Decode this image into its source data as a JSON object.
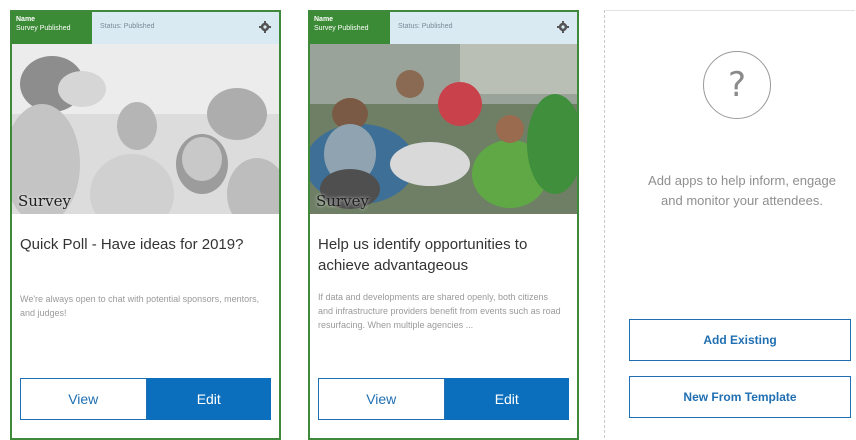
{
  "cards": [
    {
      "badge_line1": "Name",
      "badge_line2": "Survey Published",
      "status": "Status: Published",
      "photo_label": "Survey",
      "title": "Quick Poll - Have ideas for 2019?",
      "description": "We're always open to chat with potential sponsors, mentors, and judges!",
      "view_label": "View",
      "edit_label": "Edit"
    },
    {
      "badge_line1": "Name",
      "badge_line2": "Survey Published",
      "status": "Status: Published",
      "photo_label": "Survey",
      "title": "Help us identify opportunities to achieve advantageous",
      "description": "If data and developments are shared openly, both citizens and infrastructure providers benefit from events such as road resurfacing. When multiple agencies ...",
      "view_label": "View",
      "edit_label": "Edit"
    }
  ],
  "placeholder": {
    "icon_glyph": "?",
    "message": "Add apps to help inform, engage and monitor your attendees.",
    "add_existing_label": "Add Existing",
    "new_from_template_label": "New From Template"
  },
  "colors": {
    "border_green": "#3f8a3a",
    "badge_green": "#3b8a35",
    "header_blue": "#d9eaf3",
    "primary_blue": "#0b6fbd"
  },
  "icons": [
    "gear-icon",
    "question-icon"
  ]
}
